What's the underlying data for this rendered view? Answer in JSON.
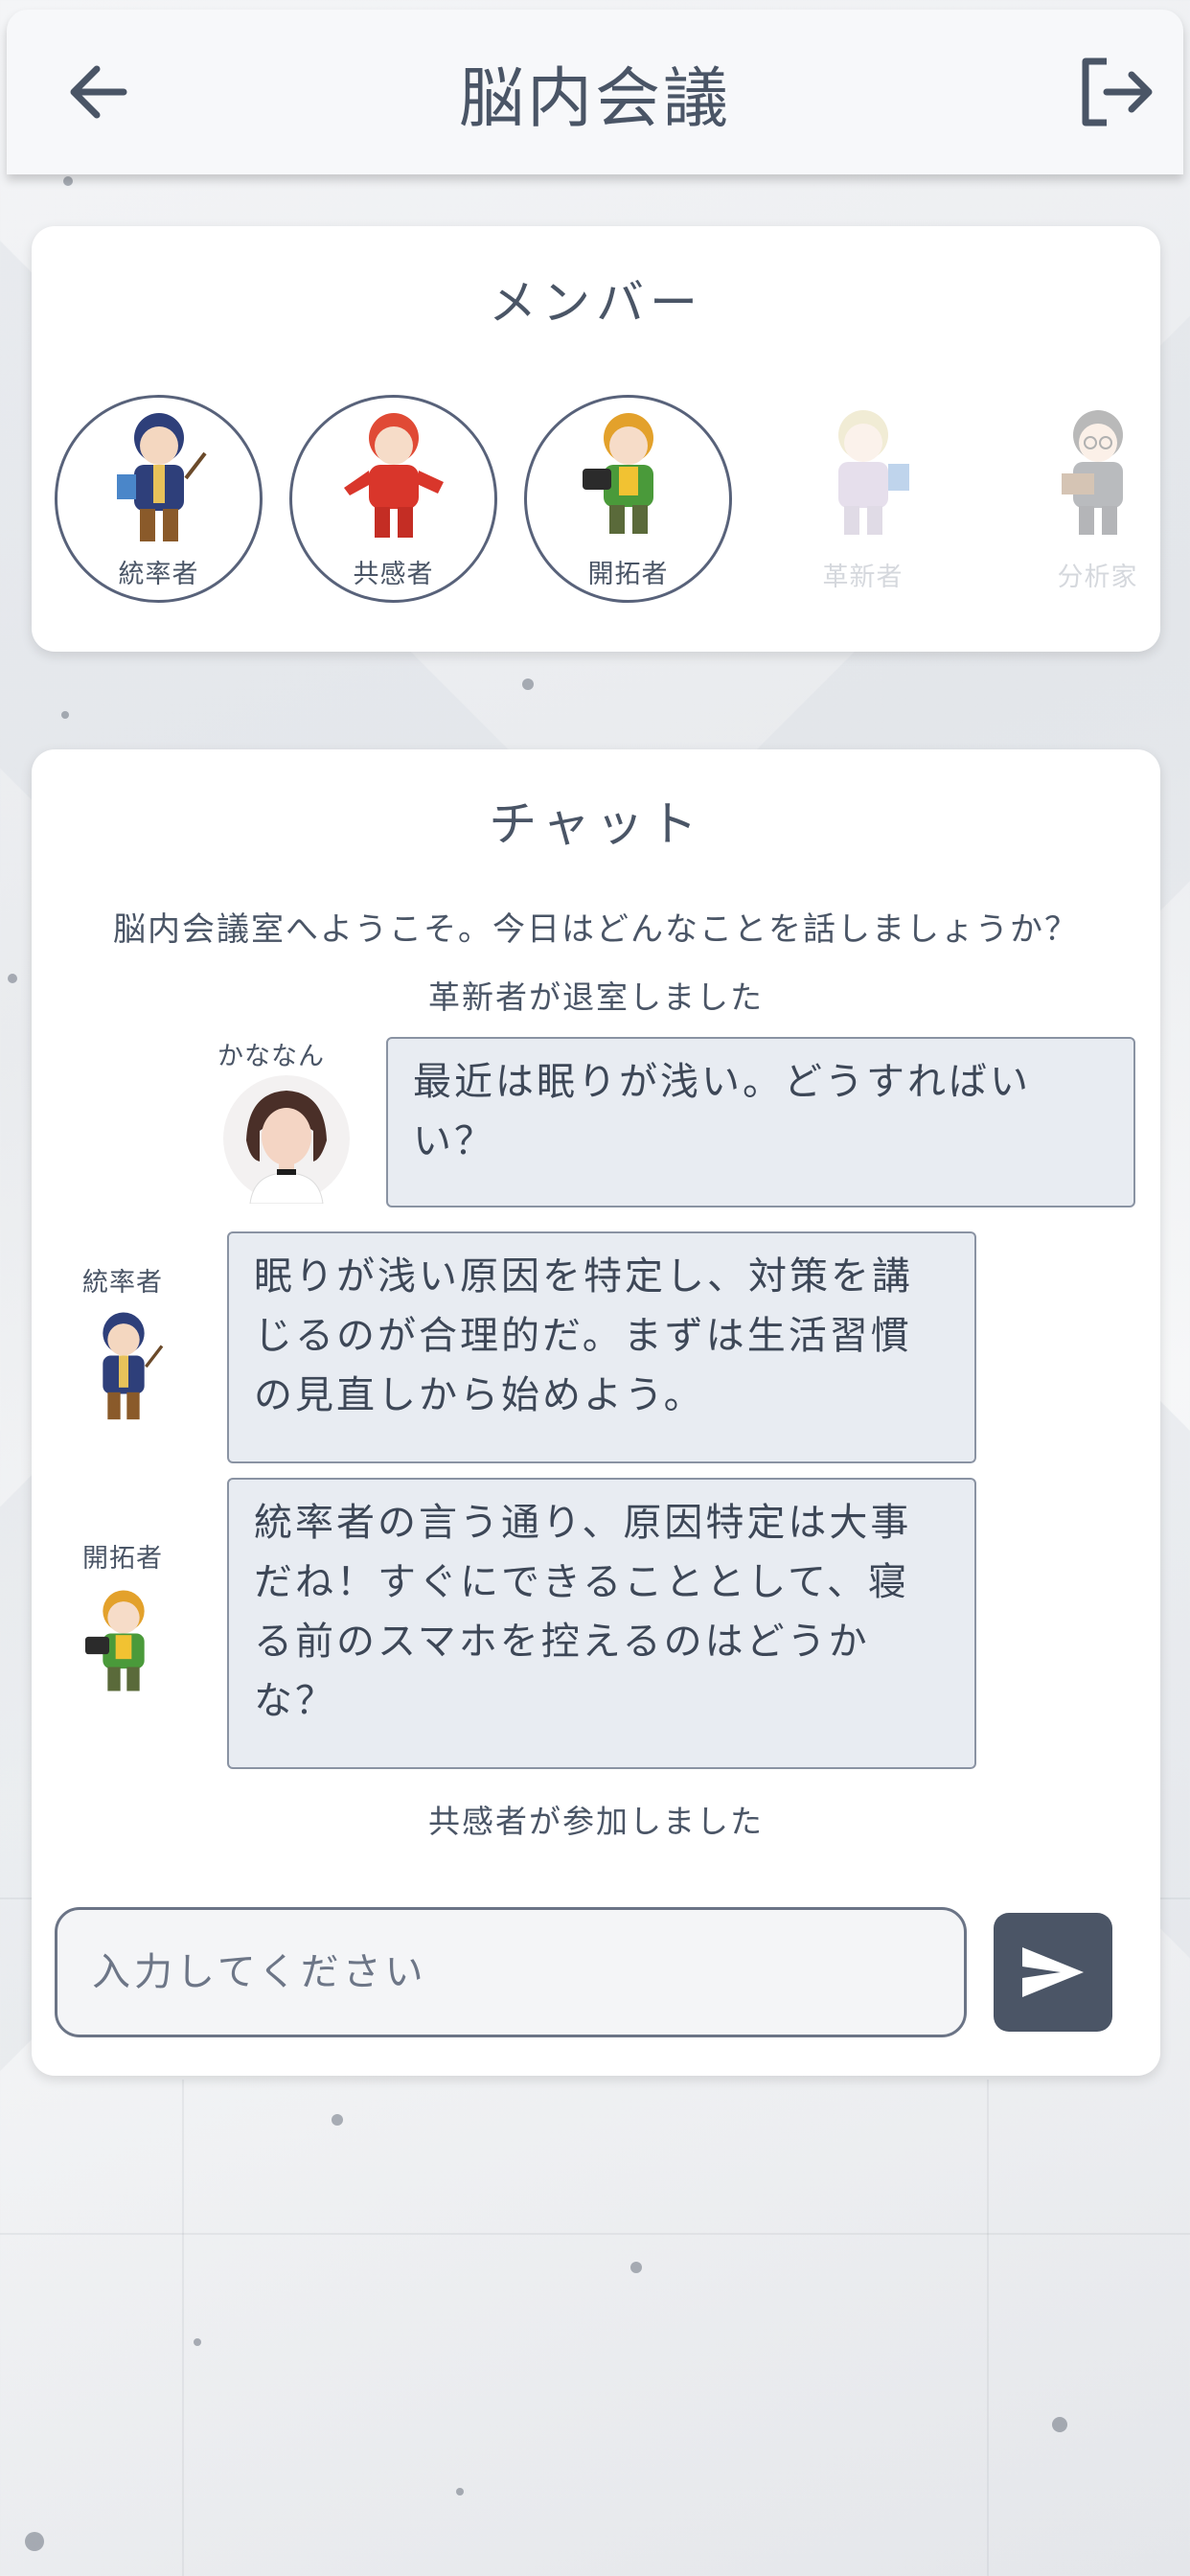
{
  "header": {
    "title": "脳内会議",
    "back_icon": "arrow-left-icon",
    "exit_icon": "logout-icon"
  },
  "members": {
    "title": "メンバー",
    "items": [
      {
        "label": "統率者",
        "active": true,
        "color": "#2e3f7a"
      },
      {
        "label": "共感者",
        "active": true,
        "color": "#d9362b"
      },
      {
        "label": "開拓者",
        "active": true,
        "color": "#e3a12b"
      },
      {
        "label": "革新者",
        "active": false,
        "color": "#d8c98a"
      },
      {
        "label": "分析家",
        "active": false,
        "color": "#6b6f78"
      }
    ]
  },
  "chat": {
    "title": "チャット",
    "welcome": "脳内会議室へようこそ。今日はどんなことを話しましょうか？",
    "system_left": "革新者が退室しました",
    "user_name": "かななん",
    "user_message": "最近は眠りが浅い。どうすればいい？",
    "msg1_name": "統率者",
    "msg1_text": "眠りが浅い原因を特定し、対策を講じるのが合理的だ。まずは生活習慣の見直しから始めよう。",
    "msg2_name": "開拓者",
    "msg2_text": "統率者の言う通り、原因特定は大事だね！すぐにできることとして、寝る前のスマホを控えるのはどうかな？",
    "system_joined": "共感者が参加しました",
    "input_placeholder": "入力してください",
    "send_icon": "send-icon"
  },
  "colors": {
    "accent": "#4b5566",
    "bubble_bg": "#e8ecf2",
    "bubble_border": "#8a93a3"
  }
}
